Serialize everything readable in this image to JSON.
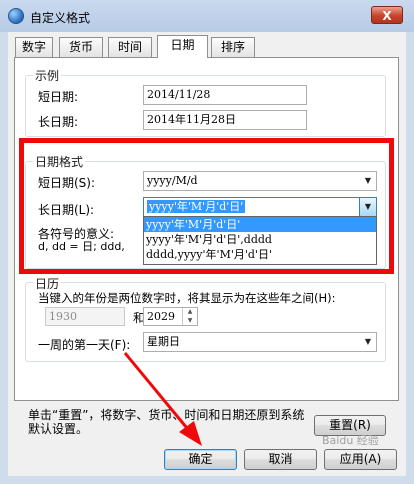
{
  "window": {
    "title": "自定义格式",
    "close_label": "X"
  },
  "tabs": [
    {
      "label": "数字"
    },
    {
      "label": "货币"
    },
    {
      "label": "时间"
    },
    {
      "label": "日期",
      "active": true
    },
    {
      "label": "排序"
    }
  ],
  "example": {
    "legend": "示例",
    "short_label": "短日期:",
    "short_value": "2014/11/28",
    "long_label": "长日期:",
    "long_value": "2014年11月28日"
  },
  "format": {
    "legend": "日期格式",
    "short_label": "短日期(S):",
    "short_value": "yyyy/M/d",
    "long_label": "长日期(L):",
    "long_value": "yyyy'年'M'月'd'日'",
    "long_options": [
      "yyyy'年'M'月'd'日'",
      "yyyy'年'M'月'd'日',dddd",
      "dddd,yyyy'年'M'月'd'日'"
    ],
    "symbols_label": "各符号的意义:",
    "symbols_text": "d, dd = 日;  ddd,"
  },
  "calendar": {
    "legend": "日历",
    "desc": "当键入的年份是两位数字时，将其显示为在这些年之间(H):",
    "year_from": "1930",
    "and_label": "和",
    "year_to": "2029",
    "first_day_label": "一周的第一天(F):",
    "first_day_value": "星期日"
  },
  "footer": {
    "reset_text": "单击“重置”，将数字、货币、时间和日期还原到系统默认设置。",
    "reset_button": "重置(R)",
    "ok_button": "确定",
    "cancel_button": "取消",
    "apply_button": "应用(A)"
  },
  "watermark": "Baidu 经验",
  "colors": {
    "highlight": "#ee0a0a",
    "selection": "#3399ff"
  }
}
